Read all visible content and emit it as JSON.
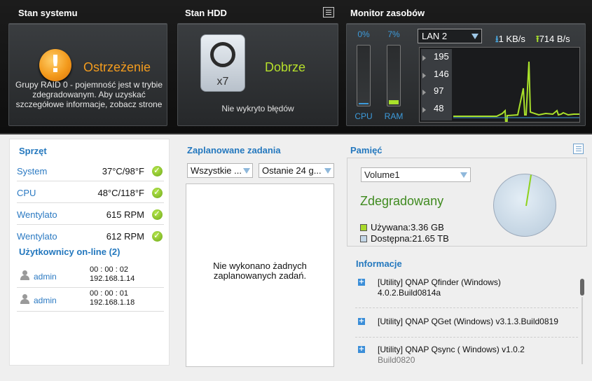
{
  "system": {
    "title": "Stan systemu",
    "status": "Ostrzeżenie",
    "message": "Grupy RAID 0 - pojemność jest w trybie zdegradowanym. Aby uzyskać szczegółowe informacje, zobacz strone"
  },
  "hdd": {
    "title": "Stan HDD",
    "count": "x7",
    "status": "Dobrze",
    "errors": "Nie wykryto błędów"
  },
  "monitor": {
    "title": "Monitor zasobów",
    "cpu_pct": "0%",
    "ram_pct": "7%",
    "cpu_label": "CPU",
    "ram_label": "RAM",
    "cpu_level": 0.0,
    "ram_level": 0.07,
    "lan_selected": "LAN 2",
    "rx_rate": "1 KB/s",
    "tx_rate": "714 B/s",
    "ticks": [
      "195",
      "146",
      "97",
      "48"
    ],
    "colors": {
      "accent_blue": "#3d9bdb",
      "lime": "#a9e12b",
      "warning": "#f39c1e"
    }
  },
  "hardware": {
    "title": "Sprzęt",
    "rows": [
      {
        "name": "System",
        "value": "37°C/98°F"
      },
      {
        "name": "CPU",
        "value": "48°C/118°F"
      },
      {
        "name": "Wentylator",
        "value": "615 RPM"
      },
      {
        "name": "Wentylator",
        "value": "612 RPM"
      }
    ]
  },
  "users": {
    "title": "Użytkownicy on-line (2)",
    "rows": [
      {
        "name": "admin",
        "time": "00 : 00 : 02",
        "ip": "192.168.1.14"
      },
      {
        "name": "admin",
        "time": "00 : 00 : 01",
        "ip": "192.168.1.18"
      }
    ]
  },
  "tasks": {
    "title": "Zaplanowane zadania",
    "filter1": "Wszystkie ...",
    "filter2": "Ostanie 24 g...",
    "empty": "Nie wykonano żadnych zaplanowanych zadań."
  },
  "memory": {
    "title": "Pamięć",
    "volume": "Volume1",
    "status": "Zdegradowany",
    "used": "Używana:3.36 GB",
    "free": "Dostępna:21.65 TB",
    "used_color": "#a9d92a",
    "free_color": "#c3d6e6"
  },
  "info": {
    "title": "Informacje",
    "items": [
      {
        "text": "[Utility] QNAP Qfinder (Windows)",
        "sub": "4.0.2.Build0814a"
      },
      {
        "text": "[Utility] QNAP QGet (Windows) v3.1.3.Build0819",
        "sub": ""
      },
      {
        "text": "[Utility] QNAP Qsync ( Windows) v1.0.2",
        "sub": "Build0820"
      }
    ]
  }
}
